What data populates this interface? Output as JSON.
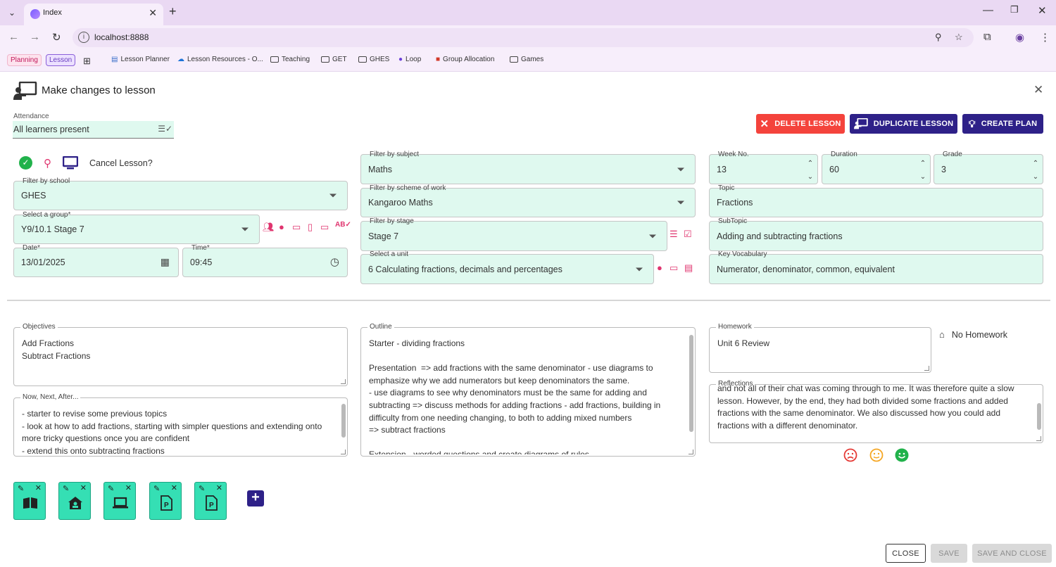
{
  "browser": {
    "tab_title": "Index",
    "url": "localhost:8888",
    "bookmarks": [
      {
        "label": "Planning"
      },
      {
        "label": "Lesson"
      },
      {
        "label": "Lesson Planner"
      },
      {
        "label": "Lesson Resources - O..."
      },
      {
        "label": "Teaching"
      },
      {
        "label": "GET"
      },
      {
        "label": "GHES"
      },
      {
        "label": "Loop"
      },
      {
        "label": "Group Allocation"
      },
      {
        "label": "Games"
      }
    ]
  },
  "dialog": {
    "title": "Make changes to lesson",
    "attendance_label": "Attendance",
    "attendance_value": "All learners present",
    "cancel_lesson": "Cancel Lesson?",
    "delete_btn": "DELETE LESSON",
    "duplicate_btn": "DUPLICATE LESSON",
    "create_plan_btn": "CREATE PLAN"
  },
  "fields": {
    "school": {
      "label": "Filter by school",
      "value": "GHES"
    },
    "group": {
      "label": "Select a group*",
      "value": "Y9/10.1 Stage 7"
    },
    "date": {
      "label": "Date*",
      "value": "13/01/2025"
    },
    "time": {
      "label": "Time*",
      "value": "09:45"
    },
    "subject": {
      "label": "Filter by subject",
      "value": "Maths"
    },
    "scheme": {
      "label": "Filter by scheme of work",
      "value": "Kangaroo Maths"
    },
    "stage": {
      "label": "Filter by stage",
      "value": "Stage 7"
    },
    "unit": {
      "label": "Select a unit",
      "value": "6 Calculating fractions, decimals and percentages"
    },
    "week": {
      "label": "Week No.",
      "value": "13"
    },
    "duration": {
      "label": "Duration",
      "value": "60"
    },
    "grade": {
      "label": "Grade",
      "value": "3"
    },
    "topic": {
      "label": "Topic",
      "value": "Fractions"
    },
    "subtopic": {
      "label": "SubTopic",
      "value": "Adding and subtracting fractions"
    },
    "vocab": {
      "label": "Key Vocabulary",
      "value": "Numerator, denominator, common, equivalent"
    }
  },
  "texts": {
    "objectives": {
      "label": "Objectives",
      "value": "Add Fractions\nSubtract Fractions"
    },
    "nna": {
      "label": "Now, Next, After...",
      "value": "- starter to revise some previous topics\n- look at how to add fractions, starting with simpler questions and extending onto more tricky questions once you are confident\n- extend this onto subtracting fractions"
    },
    "outline": {
      "label": "Outline",
      "value": "Starter - dividing fractions\n\nPresentation  => add fractions with the same denominator - use diagrams to emphasize why we add numerators but keep denominators the same.\n- use diagrams to see why denominators must be the same for adding and subtracting => discuss methods for adding fractions - add fractions, building in difficulty from one needing changing, to both to adding mixed numbers\n=> subtract fractions\n\nExtension - worded questions and create diagrams of rules"
    },
    "homework": {
      "label": "Homework",
      "value": "Unit 6 Review"
    },
    "no_homework": "No Homework",
    "reflections": {
      "label": "Reflections",
      "value": "and not all of their chat was coming through to me. It was therefore quite a slow lesson. However, by the end, they had both divided some fractions and added fractions with the same denominator. We also discussed how you could add fractions with a different denominator."
    }
  },
  "resources": [
    {
      "icon": "book-icon"
    },
    {
      "icon": "home-work-icon"
    },
    {
      "icon": "laptop-icon"
    },
    {
      "icon": "powerpoint-file-icon"
    },
    {
      "icon": "powerpoint-file-icon"
    }
  ],
  "footer": {
    "close": "CLOSE",
    "save": "SAVE",
    "save_close": "SAVE AND CLOSE"
  },
  "colors": {
    "field_bg": "#dff9ef",
    "delete": "#f4433c",
    "primary": "#2e2188",
    "pink": "#e0356f",
    "resource": "#35dfb4"
  }
}
